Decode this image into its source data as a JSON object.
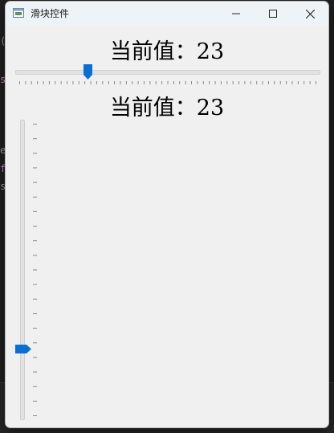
{
  "window": {
    "title": "滑块控件"
  },
  "labels": {
    "top_value": "当前值：23",
    "mid_value": "当前值：23"
  },
  "h_slider": {
    "min": 0,
    "max": 100,
    "value": 23,
    "tick_interval": 2,
    "accent": "#0a6fd3"
  },
  "v_slider": {
    "min": 0,
    "max": 100,
    "value": 23,
    "tick_interval": 5,
    "accent": "#0a6fd3"
  },
  "icons": {
    "minimize": "minimize-icon",
    "maximize": "maximize-icon",
    "close": "close-icon"
  }
}
